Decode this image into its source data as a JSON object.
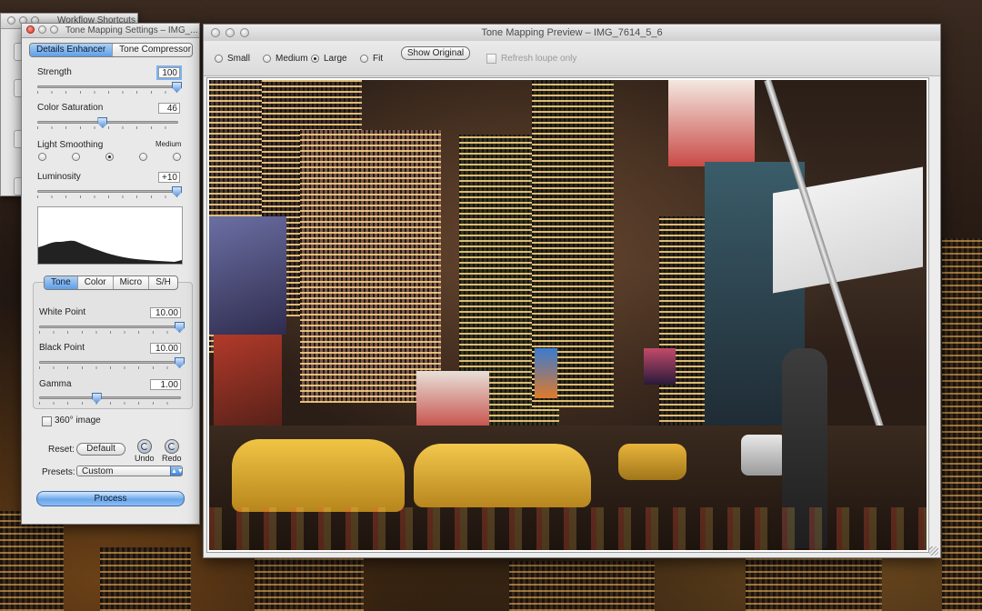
{
  "workflow_window": {
    "title": "Workflow Shortcuts"
  },
  "settings_window": {
    "title": "Tone Mapping Settings – IMG_...",
    "mode_tabs": [
      "Details Enhancer",
      "Tone Compressor"
    ],
    "active_mode": "Details Enhancer",
    "strength": {
      "label": "Strength",
      "value": "100",
      "level": 1.0
    },
    "color_saturation": {
      "label": "Color Saturation",
      "value": "46",
      "level": 0.46
    },
    "light_smoothing": {
      "label": "Light Smoothing",
      "selected_label": "Medium",
      "options_count": 5,
      "selected_index": 2
    },
    "luminosity": {
      "label": "Luminosity",
      "value": "+10",
      "level": 1.0
    },
    "sub_tabs": [
      "Tone",
      "Color",
      "Micro",
      "S/H"
    ],
    "active_sub_tab": "Tone",
    "white_point": {
      "label": "White Point",
      "value": "10.00",
      "level": 1.0
    },
    "black_point": {
      "label": "Black Point",
      "value": "10.00",
      "level": 1.0
    },
    "gamma": {
      "label": "Gamma",
      "value": "1.00",
      "level": 0.4
    },
    "image_360": {
      "label": "360° image",
      "checked": false
    },
    "reset": {
      "label": "Reset:",
      "default_button": "Default",
      "undo": "Undo",
      "redo": "Redo"
    },
    "presets": {
      "label": "Presets:",
      "value": "Custom"
    },
    "process_button": "Process"
  },
  "preview_window": {
    "title": "Tone Mapping Preview – IMG_7614_5_6",
    "size_options": [
      {
        "label": "Small",
        "selected": false
      },
      {
        "label": "Medium",
        "selected": false
      },
      {
        "label": "Large",
        "selected": true
      },
      {
        "label": "Fit",
        "selected": false
      }
    ],
    "show_original_button": "Show Original",
    "refresh_loupe": {
      "label": "Refresh loupe only",
      "checked": false,
      "disabled": true
    }
  },
  "colors": {
    "accent": "#5e9fe6",
    "window_bg": "#ececec"
  }
}
